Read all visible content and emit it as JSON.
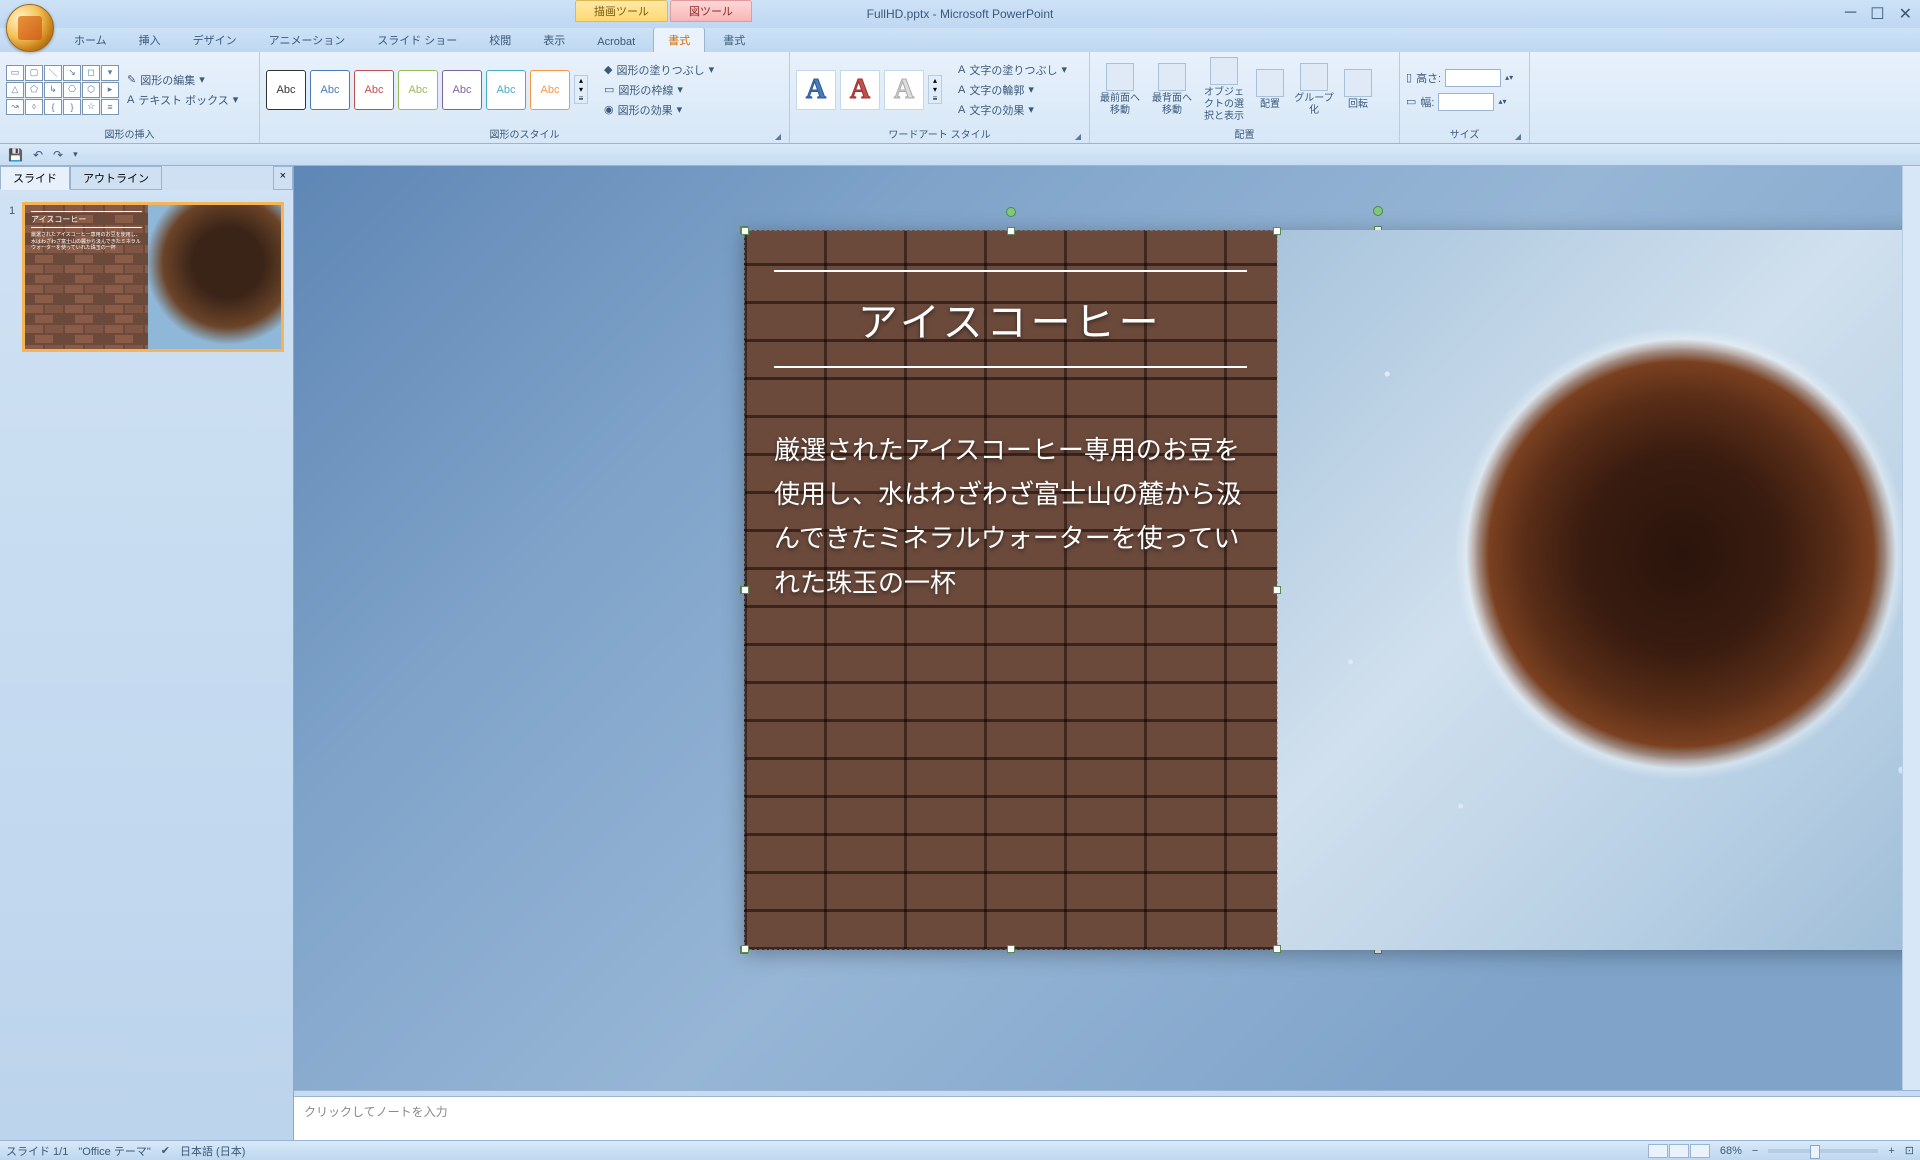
{
  "app": {
    "title": "FullHD.pptx - Microsoft PowerPoint"
  },
  "contextual": {
    "tab1": "描画ツール",
    "tab2": "図ツール"
  },
  "tabs": {
    "home": "ホーム",
    "insert": "挿入",
    "design": "デザイン",
    "anim": "アニメーション",
    "slideshow": "スライド ショー",
    "review": "校閲",
    "view": "表示",
    "acrobat": "Acrobat",
    "format1": "書式",
    "format2": "書式"
  },
  "ribbon": {
    "shapes_insert": "図形の挿入",
    "edit_shape": "図形の編集",
    "text_box": "テキスト ボックス",
    "shape_styles": "図形のスタイル",
    "shape_fill": "図形の塗りつぶし",
    "shape_outline": "図形の枠線",
    "shape_effects": "図形の効果",
    "wordart_styles": "ワードアート スタイル",
    "text_fill": "文字の塗りつぶし",
    "text_outline": "文字の輪郭",
    "text_effects": "文字の効果",
    "arrange": "配置",
    "bring_front": "最前面へ移動",
    "send_back": "最背面へ移動",
    "selection_pane": "オブジェクトの選択と表示",
    "align": "配置",
    "group": "グループ化",
    "rotate": "回転",
    "size": "サイズ",
    "height": "高さ:",
    "width": "幅:",
    "abc": "Abc"
  },
  "panel": {
    "slides": "スライド",
    "outline": "アウトライン",
    "num": "1"
  },
  "slide": {
    "title": "アイスコーヒー",
    "body": "厳選されたアイスコーヒー専用のお豆を使用し、水はわざわざ富士山の麓から汲んできたミネラルウォーターを使っていれた珠玉の一杯"
  },
  "notes": {
    "placeholder": "クリックしてノートを入力"
  },
  "status": {
    "slide_count": "スライド 1/1",
    "theme": "\"Office テーマ\"",
    "lang": "日本語 (日本)",
    "zoom": "68%"
  }
}
